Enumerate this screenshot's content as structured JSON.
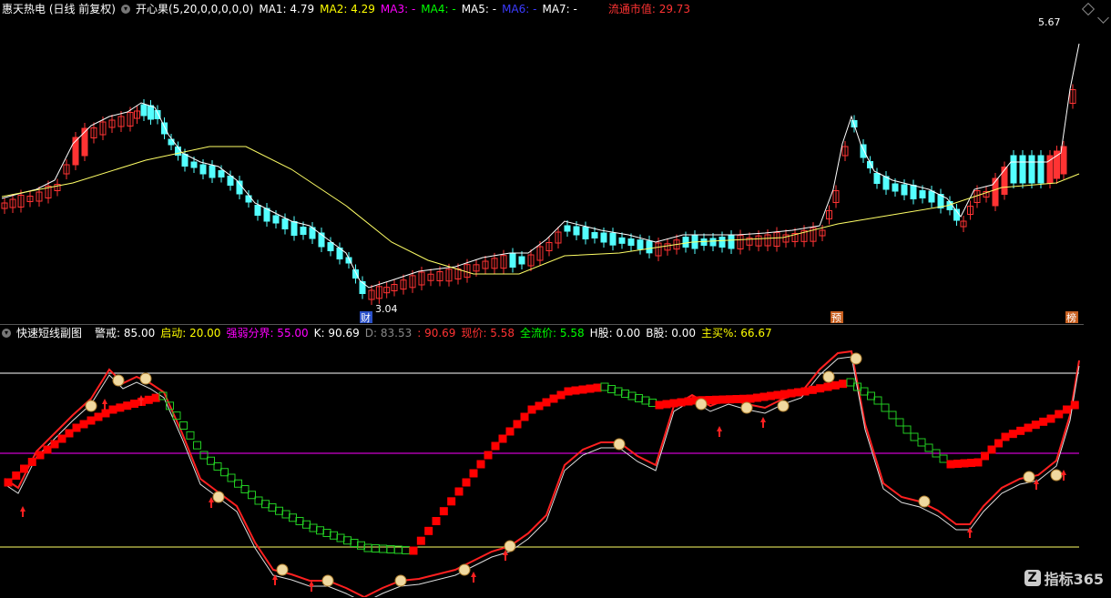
{
  "header": {
    "stock": "惠天热电 (日线 前复权)",
    "indicator": "开心果(5,20,0,0,0,0,0)",
    "ma": [
      {
        "label": "MA1: 4.79",
        "color": "#ffffff"
      },
      {
        "label": "MA2: 4.29",
        "color": "#ffff00"
      },
      {
        "label": "MA3: -",
        "color": "#ff00ff"
      },
      {
        "label": "MA4: -",
        "color": "#00ff00"
      },
      {
        "label": "MA5: -",
        "color": "#ffffff"
      },
      {
        "label": "MA6: -",
        "color": "#0000ff"
      },
      {
        "label": "MA7: -",
        "color": "#ffffff"
      }
    ],
    "market_cap": "流通市值: 29.73"
  },
  "price_chart": {
    "high_label": "5.67",
    "low_label": "3.04",
    "markers": [
      "财",
      "预",
      "榜"
    ]
  },
  "sub_header": {
    "name": "快速短线副图",
    "items": [
      {
        "label": "警戒: 85.00",
        "color": "#ffffff"
      },
      {
        "label": "启动: 20.00",
        "color": "#ffff00"
      },
      {
        "label": "强弱分界: 55.00",
        "color": "#ff00ff"
      },
      {
        "label": "K: 90.69",
        "color": "#ffffff"
      },
      {
        "label": "D: 83.53",
        "color": "#888888"
      },
      {
        "label": ": 90.69",
        "color": "#ff3333"
      },
      {
        "label": "现价: 5.58",
        "color": "#ff3333"
      },
      {
        "label": "全流价: 5.58",
        "color": "#00ff00"
      },
      {
        "label": "H股: 0.00",
        "color": "#ffffff"
      },
      {
        "label": "B股: 0.00",
        "color": "#ffffff"
      },
      {
        "label": "主买%: 66.67",
        "color": "#ffff00"
      }
    ]
  },
  "watermark": "指标365",
  "colors": {
    "up": "#ff3333",
    "down": "#54ffff",
    "ma1": "#ffffff",
    "ma2": "#ffff66"
  }
}
